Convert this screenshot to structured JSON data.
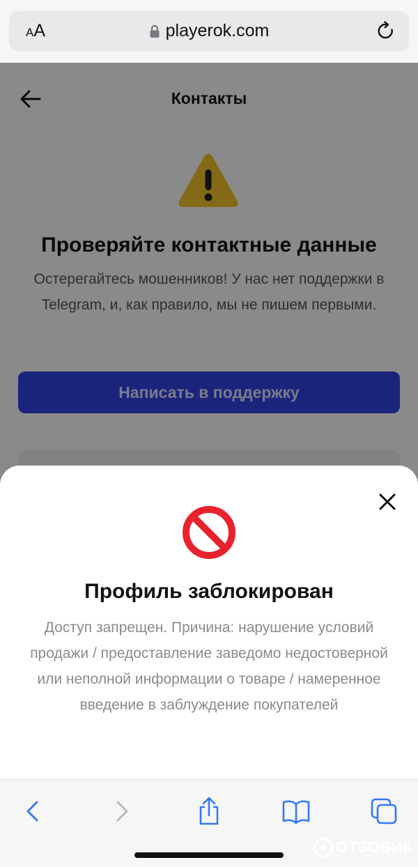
{
  "browser": {
    "text_size_label": "AA",
    "url": "playerok.com",
    "toolbar_icons": [
      "back-icon",
      "forward-icon",
      "share-icon",
      "bookmarks-icon",
      "tabs-icon"
    ],
    "accent_color": "#3478f6"
  },
  "page": {
    "title": "Контакты",
    "heading": "Проверяйте контактные данные",
    "notice": "Остерегайтесь мошенников! У нас нет поддержки в Telegram, и, как правило, мы не пишем первыми.",
    "support_button": "Написать в поддержку",
    "button_color": "#3344e6"
  },
  "modal": {
    "title": "Профиль заблокирован",
    "body": "Доступ запрещен. Причина: нарушение условий продажи / предоставление заведомо недостоверной или неполной информации о товаре / намеренное введение в заблуждение покупателей"
  },
  "watermark": {
    "text": "ОТЗОВИК"
  }
}
